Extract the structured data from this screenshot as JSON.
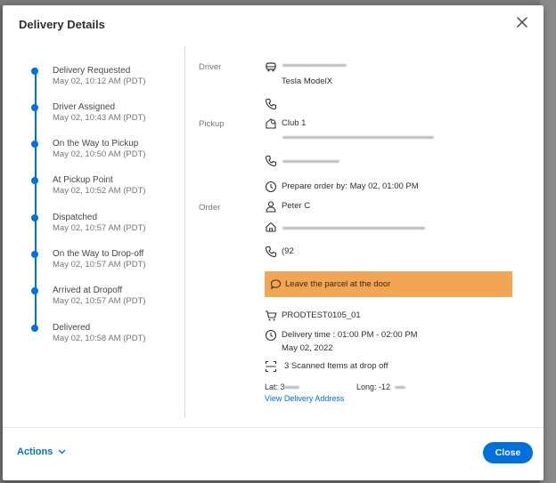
{
  "modal": {
    "title": "Delivery Details",
    "close_icon": "close-icon"
  },
  "timeline": [
    {
      "label": "Delivery Requested",
      "time": "May 02, 10:12 AM (PDT)"
    },
    {
      "label": "Driver Assigned",
      "time": "May 02, 10:43 AM (PDT)"
    },
    {
      "label": "On the Way to Pickup",
      "time": "May 02, 10:50 AM (PDT)"
    },
    {
      "label": "At Pickup Point",
      "time": "May 02, 10:52 AM (PDT)"
    },
    {
      "label": "Dispatched",
      "time": "May 02, 10:57 AM (PDT)"
    },
    {
      "label": "On the Way to Drop-off",
      "time": "May 02, 10:57 AM (PDT)"
    },
    {
      "label": "Arrived at Dropoff",
      "time": "May 02, 10:57 AM (PDT)"
    },
    {
      "label": "Delivered",
      "time": "May 02, 10:58 AM (PDT)"
    }
  ],
  "details": {
    "driver_label": "Driver",
    "vehicle": "Tesla ModelX",
    "pickup_label": "Pickup",
    "store": "Club 1",
    "prepare_by": "Prepare order by: May 02, 01:00 PM",
    "order_label": "Order",
    "customer": "Peter C",
    "phone": "(92",
    "note": "Leave the parcel at the door",
    "order_id": "PRODTEST0105_01",
    "delivery_time": "Delivery time : 01:00 PM - 02:00 PM",
    "delivery_date": "May 02, 2022",
    "scanned": "3 Scanned Items at drop off",
    "lat": "Lat: 3",
    "long": "Long: -12",
    "view_address": "View Delivery Address"
  },
  "footer": {
    "actions_label": "Actions",
    "close_label": "Close"
  },
  "colors": {
    "accent": "#0071dc",
    "note_bg": "#f2a654"
  }
}
